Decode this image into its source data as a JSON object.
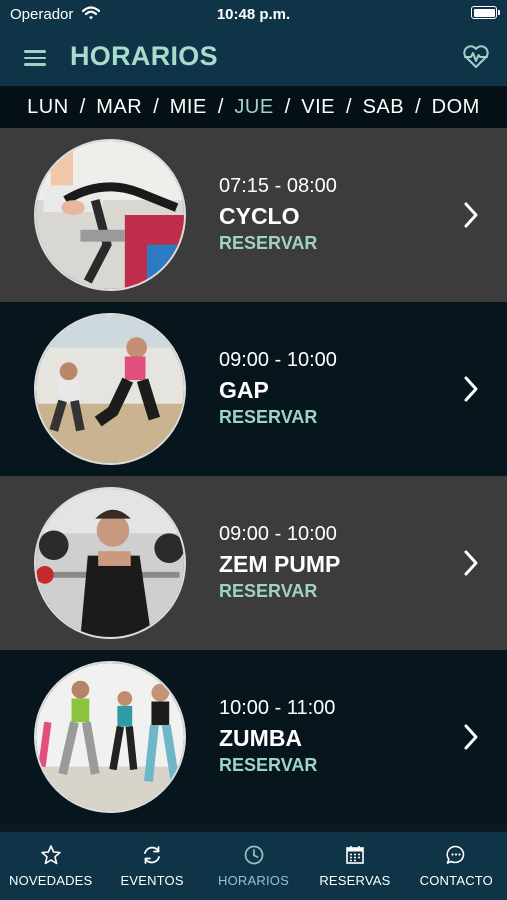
{
  "status_bar": {
    "carrier": "Operador",
    "time": "10:48 p.m."
  },
  "header": {
    "title": "HORARIOS"
  },
  "days": [
    {
      "label": "LUN",
      "active": false
    },
    {
      "label": "MAR",
      "active": false
    },
    {
      "label": "MIE",
      "active": false
    },
    {
      "label": "JUE",
      "active": true
    },
    {
      "label": "VIE",
      "active": false
    },
    {
      "label": "SAB",
      "active": false
    },
    {
      "label": "DOM",
      "active": false
    }
  ],
  "day_separator": "/",
  "classes": [
    {
      "time": "07:15 - 08:00",
      "name": "CYCLO",
      "action": "RESERVAR"
    },
    {
      "time": "09:00 - 10:00",
      "name": "GAP",
      "action": "RESERVAR"
    },
    {
      "time": "09:00 - 10:00",
      "name": "ZEM PUMP",
      "action": "RESERVAR"
    },
    {
      "time": "10:00 - 11:00",
      "name": "ZUMBA",
      "action": "RESERVAR"
    }
  ],
  "tabs": [
    {
      "label": "NOVEDADES",
      "icon": "star-icon",
      "active": false
    },
    {
      "label": "EVENTOS",
      "icon": "refresh-icon",
      "active": false
    },
    {
      "label": "HORARIOS",
      "icon": "clock-icon",
      "active": true
    },
    {
      "label": "RESERVAS",
      "icon": "calendar-icon",
      "active": false
    },
    {
      "label": "CONTACTO",
      "icon": "chat-icon",
      "active": false
    }
  ],
  "colors": {
    "header_bg": "#0f3347",
    "accent": "#9fd3c7",
    "row_light": "#3c3c3c",
    "row_dark": "#07161c",
    "active_tab": "#8fc6c8"
  }
}
